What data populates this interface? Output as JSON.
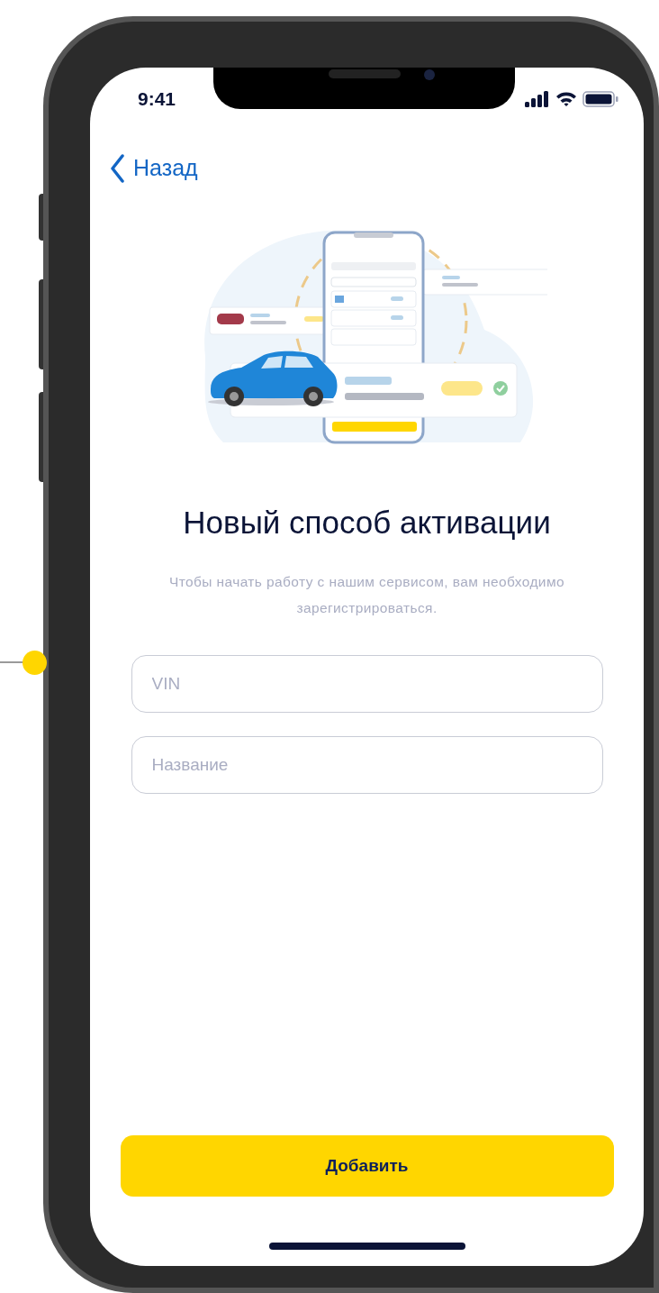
{
  "status_bar": {
    "time": "9:41"
  },
  "nav": {
    "back_label": "Назад"
  },
  "title": "Новый способ активации",
  "subtitle": "Чтобы начать работу с нашим сервисом, вам необходимо зарегистрироваться.",
  "fields": [
    {
      "placeholder": "VIN"
    },
    {
      "placeholder": "Название"
    }
  ],
  "button": {
    "label": "Добавить"
  }
}
